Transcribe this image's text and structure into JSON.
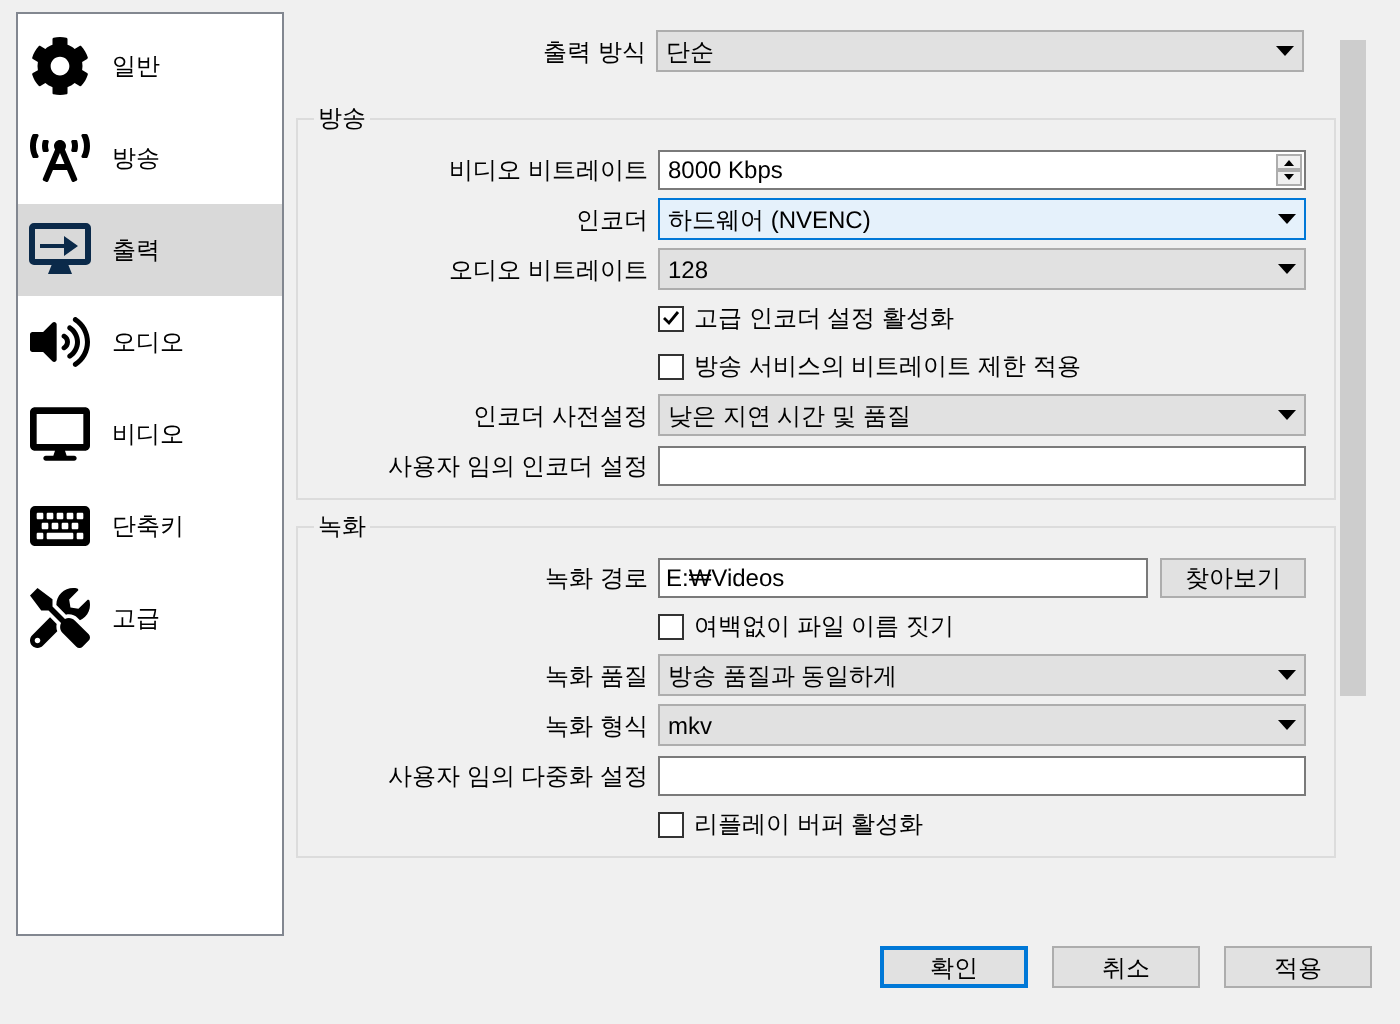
{
  "sidebar": {
    "items": [
      {
        "label": "일반",
        "selected": false
      },
      {
        "label": "방송",
        "selected": false
      },
      {
        "label": "출력",
        "selected": true
      },
      {
        "label": "오디오",
        "selected": false
      },
      {
        "label": "비디오",
        "selected": false
      },
      {
        "label": "단축키",
        "selected": false
      },
      {
        "label": "고급",
        "selected": false
      }
    ]
  },
  "output_mode": {
    "label": "출력 방식",
    "value": "단순"
  },
  "sections": [
    {
      "title": "방송",
      "rows": [
        {
          "kind": "spin",
          "label": "비디오 비트레이트",
          "value": "8000 Kbps"
        },
        {
          "kind": "select",
          "label": "인코더",
          "value": "하드웨어 (NVENC)",
          "focused": true
        },
        {
          "kind": "select",
          "label": "오디오 비트레이트",
          "value": "128",
          "focused": false
        },
        {
          "kind": "checkbox",
          "label": "고급 인코더 설정 활성화",
          "checked": true
        },
        {
          "kind": "checkbox",
          "label": "방송 서비스의 비트레이트 제한 적용",
          "checked": false
        },
        {
          "kind": "select",
          "label": "인코더 사전설정",
          "value": "낮은 지연 시간 및 품질",
          "focused": false
        },
        {
          "kind": "text",
          "label": "사용자 임의 인코더 설정"
        }
      ]
    },
    {
      "title": "녹화",
      "rows": [
        {
          "kind": "browse",
          "label": "녹화 경로",
          "value": "E:₩Videos",
          "button": "찾아보기"
        },
        {
          "kind": "checkbox",
          "label": "여백없이 파일 이름 짓기",
          "checked": false
        },
        {
          "kind": "select",
          "label": "녹화 품질",
          "value": "방송 품질과 동일하게",
          "focused": false
        },
        {
          "kind": "select",
          "label": "녹화 형식",
          "value": "mkv",
          "focused": false
        },
        {
          "kind": "text",
          "label": "사용자 임의 다중화 설정"
        },
        {
          "kind": "checkbox",
          "label": "리플레이 버퍼 활성화",
          "checked": false
        }
      ]
    }
  ],
  "buttons": [
    {
      "label": "확인",
      "default": true
    },
    {
      "label": "취소",
      "default": false
    },
    {
      "label": "적용",
      "default": false
    }
  ]
}
